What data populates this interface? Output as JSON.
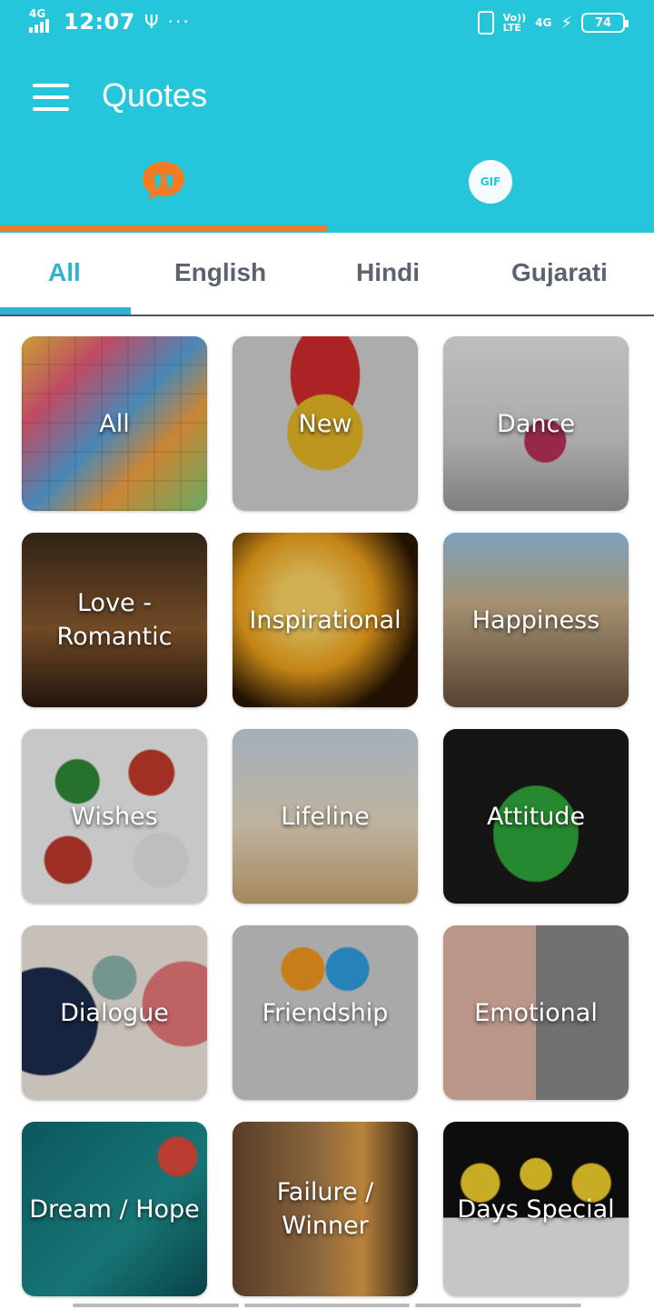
{
  "status_bar": {
    "network_left": "4G",
    "time": "12:07",
    "usb": "Ψ",
    "more": "···",
    "volte_line1": "Vo))",
    "volte_line2": "LTE",
    "network_right": "4G",
    "battery": "74"
  },
  "app_bar": {
    "title": "Quotes",
    "gif_label": "GIF",
    "accent": "#26c6da",
    "tab_indicator_color": "#f47b20"
  },
  "sub_tabs": {
    "items": [
      "All",
      "English",
      "Hindi",
      "Gujarati"
    ],
    "active": "All",
    "active_color": "#2db4d2"
  },
  "categories": [
    "All",
    "New",
    "Dance",
    "Love - Romantic",
    "Inspirational",
    "Happiness",
    "Wishes",
    "Lifeline",
    "Attitude",
    "Dialogue",
    "Friendship",
    "Emotional",
    "Dream / Hope",
    "Failure / Winner",
    "Days Special"
  ]
}
